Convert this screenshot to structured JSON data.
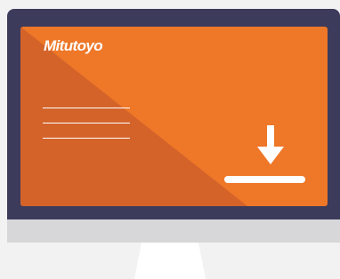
{
  "brand": {
    "logo_text": "Mitutoyo"
  },
  "colors": {
    "screen": "#ee7728",
    "screen_shade": "#d4632a",
    "bezel": "#3d3b5b",
    "chin": "#d7d7d9",
    "background": "#f2f2f3",
    "stand": "#ffffff"
  },
  "icons": [
    "download-icon"
  ]
}
